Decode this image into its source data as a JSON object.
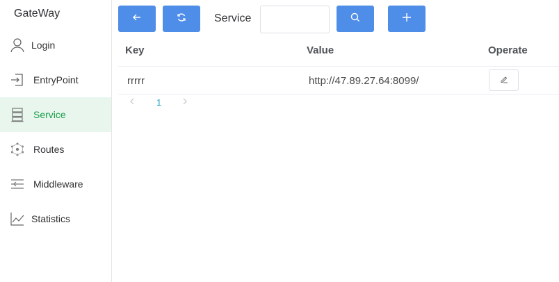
{
  "app": {
    "brand": "GateWay"
  },
  "sidebar": {
    "items": [
      {
        "label": "Login",
        "icon": "user-icon",
        "active": false
      },
      {
        "label": "EntryPoint",
        "icon": "entry-icon",
        "active": false
      },
      {
        "label": "Service",
        "icon": "server-icon",
        "active": true
      },
      {
        "label": "Routes",
        "icon": "network-icon",
        "active": false
      },
      {
        "label": "Middleware",
        "icon": "middleware-icon",
        "active": false
      },
      {
        "label": "Statistics",
        "icon": "chart-line-icon",
        "active": false
      }
    ]
  },
  "toolbar": {
    "back_icon": "arrow-left-icon",
    "refresh_icon": "refresh-icon",
    "service_label": "Service",
    "service_value": "",
    "search_icon": "search-icon",
    "add_icon": "plus-icon"
  },
  "table": {
    "headers": {
      "key": "Key",
      "value": "Value",
      "operate": "Operate"
    },
    "rows": [
      {
        "key": "rrrrr",
        "value": "http://47.89.27.64:8099/",
        "operate_icon": "edit-icon"
      }
    ]
  },
  "pagination": {
    "current": "1"
  },
  "colors": {
    "primary": "#4f8ee8",
    "active_text": "#1aa04a",
    "active_bg": "#e8f6ee",
    "page_current": "#1aa0c8"
  }
}
